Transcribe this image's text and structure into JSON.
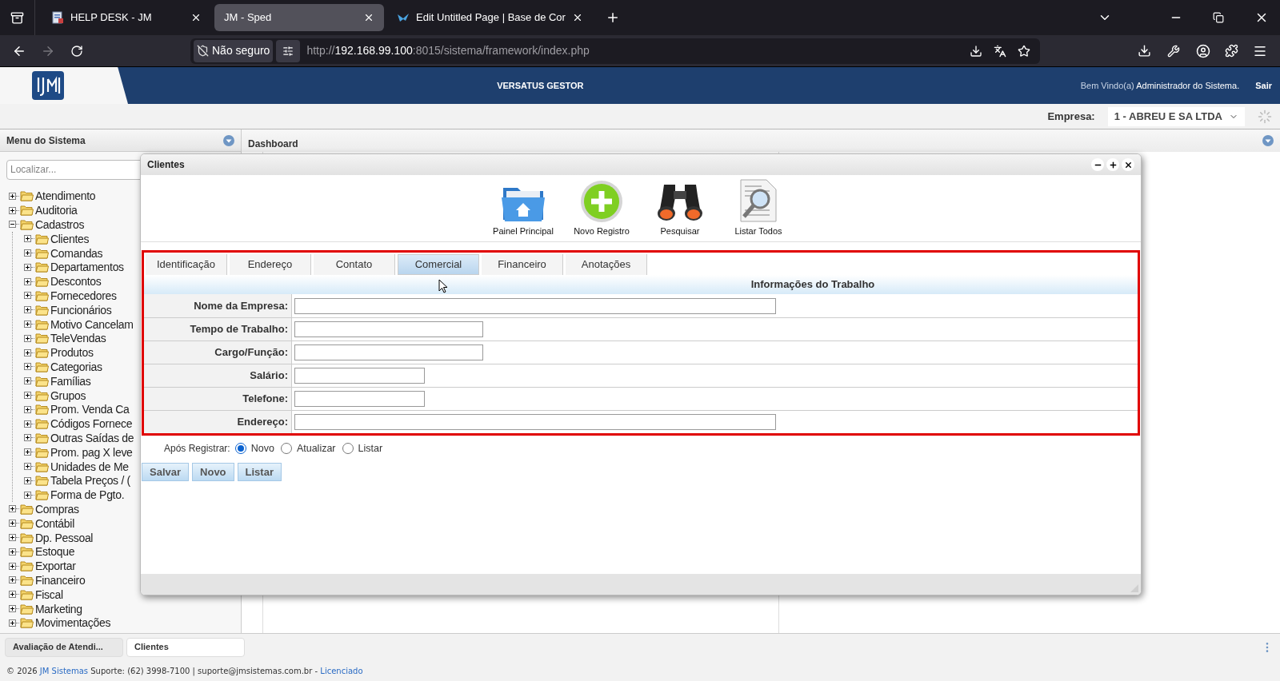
{
  "browser": {
    "tabs": [
      {
        "title": "HELP DESK - JM",
        "selected": false,
        "kind": "helpdesk"
      },
      {
        "title": "JM - Sped",
        "selected": true,
        "kind": "plain"
      },
      {
        "title": "Edit Untitled Page | Base de Cor",
        "selected": false,
        "kind": "editor"
      }
    ],
    "address": {
      "security": "Não seguro",
      "scheme": "http://",
      "host": "192.168.99.100",
      "rest": ":8015/sistema/framework/index.php"
    }
  },
  "header": {
    "title": "VERSATUS GESTOR",
    "welcome": "Bem Vindo(a)",
    "user": "Administrador do Sistema.",
    "logout": "Sair"
  },
  "company": {
    "label": "Empresa:",
    "value": "1 - ABREU E SA LTDA"
  },
  "sidebar": {
    "title": "Menu do Sistema",
    "search_placeholder": "Localizar...",
    "tree": [
      {
        "label": "Atendimento",
        "expanded": false
      },
      {
        "label": "Auditoria",
        "expanded": false
      },
      {
        "label": "Cadastros",
        "expanded": true,
        "children": [
          {
            "label": "Clientes",
            "expanded": false
          },
          {
            "label": "Comandas",
            "expanded": false
          },
          {
            "label": "Departamentos",
            "expanded": false
          },
          {
            "label": "Descontos",
            "expanded": false
          },
          {
            "label": "Fornecedores",
            "expanded": false
          },
          {
            "label": "Funcionários",
            "expanded": false
          },
          {
            "label": "Motivo Cancelam",
            "expanded": false
          },
          {
            "label": "TeleVendas",
            "expanded": false
          },
          {
            "label": "Produtos",
            "expanded": false
          },
          {
            "label": "Categorias",
            "expanded": false
          },
          {
            "label": "Famílias",
            "expanded": false
          },
          {
            "label": "Grupos",
            "expanded": false
          },
          {
            "label": "Prom. Venda Ca",
            "expanded": false
          },
          {
            "label": "Códigos Fornece",
            "expanded": false
          },
          {
            "label": "Outras Saídas de",
            "expanded": false
          },
          {
            "label": "Prom. pag X leve",
            "expanded": false
          },
          {
            "label": "Unidades de Me",
            "expanded": false
          },
          {
            "label": "Tabela Preços / (",
            "expanded": false
          },
          {
            "label": "Forma de Pgto.",
            "expanded": false
          }
        ]
      },
      {
        "label": "Compras",
        "expanded": false
      },
      {
        "label": "Contábil",
        "expanded": false
      },
      {
        "label": "Dp. Pessoal",
        "expanded": false
      },
      {
        "label": "Estoque",
        "expanded": false
      },
      {
        "label": "Exportar",
        "expanded": false
      },
      {
        "label": "Financeiro",
        "expanded": false
      },
      {
        "label": "Fiscal",
        "expanded": false
      },
      {
        "label": "Marketing",
        "expanded": false
      },
      {
        "label": "Movimentações",
        "expanded": false
      }
    ]
  },
  "main": {
    "title": "Dashboard"
  },
  "dialog": {
    "title": "Clientes",
    "toolbar": [
      {
        "label": "Painel Principal",
        "kind": "home"
      },
      {
        "label": "Novo Registro",
        "kind": "add"
      },
      {
        "label": "Pesquisar",
        "kind": "search"
      },
      {
        "label": "Listar Todos",
        "kind": "list"
      }
    ],
    "tabs": [
      {
        "label": "Identificação",
        "selected": false
      },
      {
        "label": "Endereço",
        "selected": false
      },
      {
        "label": "Contato",
        "selected": false
      },
      {
        "label": "Comercial",
        "selected": true
      },
      {
        "label": "Financeiro",
        "selected": false
      },
      {
        "label": "Anotações",
        "selected": false
      }
    ],
    "section_title": "Informações do Trabalho",
    "fields": [
      {
        "label": "Nome da Empresa:",
        "kind": "long"
      },
      {
        "label": "Tempo de Trabalho:",
        "kind": "medium"
      },
      {
        "label": "Cargo/Função:",
        "kind": "medium"
      },
      {
        "label": "Salário:",
        "kind": "short"
      },
      {
        "label": "Telefone:",
        "kind": "short"
      },
      {
        "label": "Endereço:",
        "kind": "long"
      }
    ],
    "after_save": {
      "label": "Após Registrar:",
      "options": [
        {
          "label": "Novo",
          "selected": true
        },
        {
          "label": "Atualizar",
          "selected": false
        },
        {
          "label": "Listar",
          "selected": false
        }
      ]
    },
    "buttons": [
      "Salvar",
      "Novo",
      "Listar"
    ]
  },
  "taskbar": [
    {
      "label": "Avaliação de Atendi...",
      "selected": false
    },
    {
      "label": "Clientes",
      "selected": true
    }
  ],
  "footer": {
    "prefix": "© 2026",
    "brand": "JM Sistemas",
    "contact": "Suporte: (62) 3998-7100 | suporte@jmsistemas.com.br -",
    "license": "Licenciado"
  }
}
